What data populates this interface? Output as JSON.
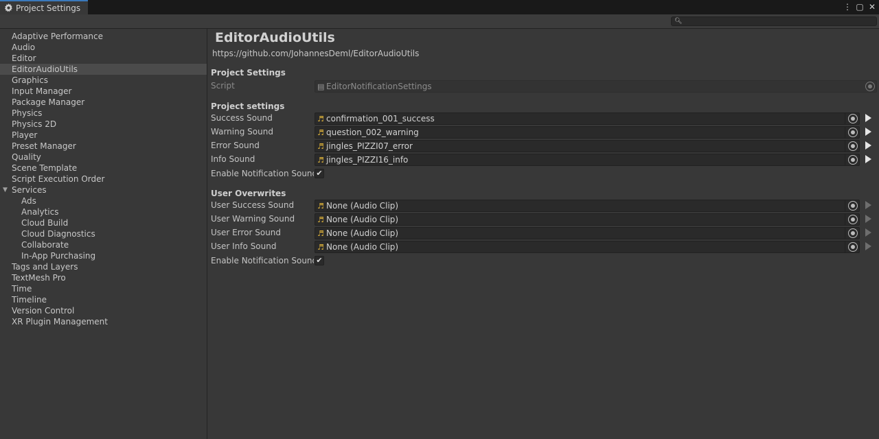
{
  "window": {
    "tab_title": "Project Settings",
    "buttons": [
      "⋮",
      "▢",
      "✕"
    ]
  },
  "search": {
    "placeholder": "",
    "value": ""
  },
  "sidebar": {
    "items": [
      {
        "label": "Adaptive Performance",
        "indent": 0
      },
      {
        "label": "Audio",
        "indent": 0
      },
      {
        "label": "Editor",
        "indent": 0
      },
      {
        "label": "EditorAudioUtils",
        "indent": 0,
        "selected": true
      },
      {
        "label": "Graphics",
        "indent": 0
      },
      {
        "label": "Input Manager",
        "indent": 0
      },
      {
        "label": "Package Manager",
        "indent": 0
      },
      {
        "label": "Physics",
        "indent": 0
      },
      {
        "label": "Physics 2D",
        "indent": 0
      },
      {
        "label": "Player",
        "indent": 0
      },
      {
        "label": "Preset Manager",
        "indent": 0
      },
      {
        "label": "Quality",
        "indent": 0
      },
      {
        "label": "Scene Template",
        "indent": 0
      },
      {
        "label": "Script Execution Order",
        "indent": 0
      },
      {
        "label": "Services",
        "indent": 0,
        "expanded": true
      },
      {
        "label": "Ads",
        "indent": 1
      },
      {
        "label": "Analytics",
        "indent": 1
      },
      {
        "label": "Cloud Build",
        "indent": 1
      },
      {
        "label": "Cloud Diagnostics",
        "indent": 1
      },
      {
        "label": "Collaborate",
        "indent": 1
      },
      {
        "label": "In-App Purchasing",
        "indent": 1
      },
      {
        "label": "Tags and Layers",
        "indent": 0
      },
      {
        "label": "TextMesh Pro",
        "indent": 0
      },
      {
        "label": "Time",
        "indent": 0
      },
      {
        "label": "Timeline",
        "indent": 0
      },
      {
        "label": "Version Control",
        "indent": 0
      },
      {
        "label": "XR Plugin Management",
        "indent": 0
      }
    ]
  },
  "main": {
    "title": "EditorAudioUtils",
    "url": "https://github.com/JohannesDeml/EditorAudioUtils",
    "project_settings_header": "Project Settings",
    "script": {
      "label": "Script",
      "value": "EditorNotificationSettings"
    },
    "settings_header": "Project settings",
    "sounds": [
      {
        "label": "Success Sound",
        "value": "confirmation_001_success"
      },
      {
        "label": "Warning Sound",
        "value": "question_002_warning"
      },
      {
        "label": "Error Sound",
        "value": "jingles_PIZZI07_error"
      },
      {
        "label": "Info Sound",
        "value": "jingles_PIZZI16_info"
      }
    ],
    "enable_label": "Enable Notification Sounds",
    "enable_checked": true,
    "user_header": "User Overwrites",
    "user_sounds": [
      {
        "label": "User Success Sound",
        "value": "None (Audio Clip)"
      },
      {
        "label": "User Warning Sound",
        "value": "None (Audio Clip)"
      },
      {
        "label": "User Error Sound",
        "value": "None (Audio Clip)"
      },
      {
        "label": "User Info Sound",
        "value": "None (Audio Clip)"
      }
    ],
    "user_enable_label": "Enable Notification Sounds",
    "user_enable_checked": true
  },
  "colors": {
    "accent": "#3a79bb",
    "audio_icon": "#e0b43a",
    "background": "#383838"
  },
  "icons": {
    "audio_clip": "music-note-icon",
    "script": "script-file-icon",
    "picker": "object-picker-icon",
    "play": "play-icon"
  }
}
